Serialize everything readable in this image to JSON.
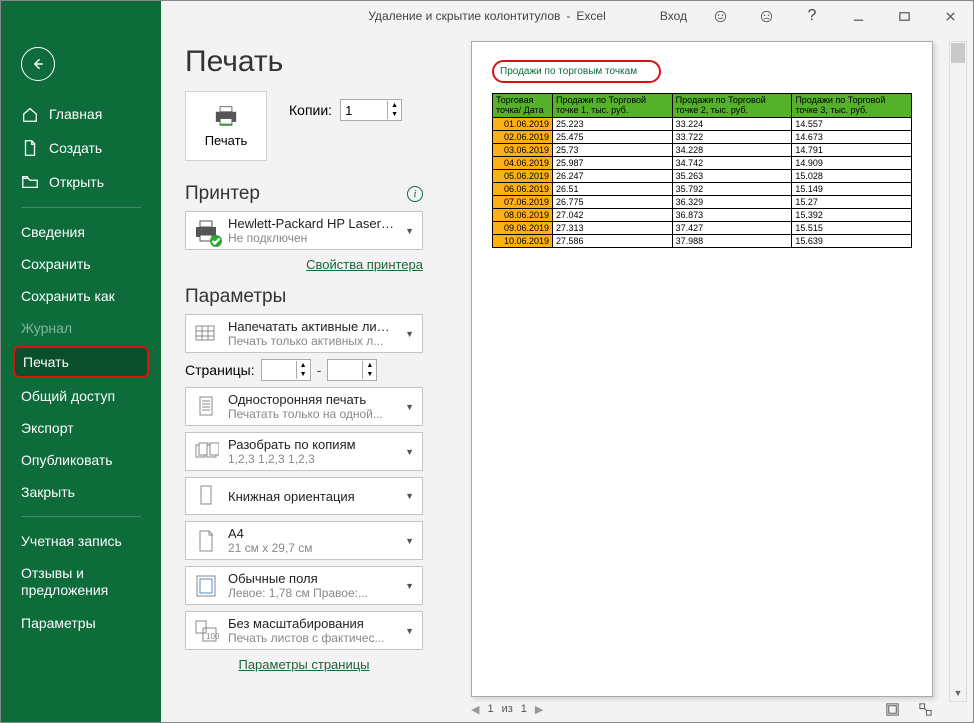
{
  "titlebar": {
    "doc": "Удаление и скрытие колонтитулов",
    "app": "Excel",
    "login": "Вход"
  },
  "sidebar": {
    "home": "Главная",
    "new": "Создать",
    "open": "Открыть",
    "info": "Сведения",
    "save": "Сохранить",
    "saveas": "Сохранить как",
    "history": "Журнал",
    "print": "Печать",
    "share": "Общий доступ",
    "export": "Экспорт",
    "publish": "Опубликовать",
    "close": "Закрыть",
    "account": "Учетная запись",
    "feedback": "Отзывы и предложения",
    "options": "Параметры"
  },
  "main": {
    "title": "Печать",
    "printBtn": "Печать",
    "copiesLabel": "Копии:",
    "copies": "1",
    "printerHeading": "Принтер",
    "printer": {
      "name": "Hewlett-Packard HP LaserJe...",
      "status": "Не подключен"
    },
    "printerProps": "Свойства принтера",
    "paramsHeading": "Параметры",
    "pagesLabel": "Страницы:",
    "pageSetup": "Параметры страницы",
    "drops": {
      "what": {
        "l1": "Напечатать активные листы",
        "l2": "Печать только активных л..."
      },
      "sides": {
        "l1": "Односторонняя печать",
        "l2": "Печатать только на одной..."
      },
      "collate": {
        "l1": "Разобрать по копиям",
        "l2": "1,2,3   1,2,3   1,2,3"
      },
      "orient": {
        "l1": "Книжная ориентация",
        "l2": ""
      },
      "paper": {
        "l1": "A4",
        "l2": "21 см x 29,7 см"
      },
      "margins": {
        "l1": "Обычные поля",
        "l2": "Левое:  1,78 см   Правое:..."
      },
      "scale": {
        "l1": "Без масштабирования",
        "l2": "Печать листов с фактичес..."
      }
    }
  },
  "preview": {
    "header": "Продажи по торговым точкам",
    "cols": [
      "Торговая точка/\nДата",
      "Продажи по Торговой точке 1, тыс. руб.",
      "Продажи по Торговой точке 2, тыс. руб.",
      "Продажи по Торговой точке 3, тыс. руб."
    ],
    "rows": [
      [
        "01.06.2019",
        "25.223",
        "33.224",
        "14.557"
      ],
      [
        "02.06.2019",
        "25.475",
        "33.722",
        "14.673"
      ],
      [
        "03.06.2019",
        "25.73",
        "34.228",
        "14.791"
      ],
      [
        "04.06.2019",
        "25.987",
        "34.742",
        "14.909"
      ],
      [
        "05.06.2019",
        "26.247",
        "35.263",
        "15.028"
      ],
      [
        "06.06.2019",
        "26.51",
        "35.792",
        "15.149"
      ],
      [
        "07.06.2019",
        "26.775",
        "36.329",
        "15.27"
      ],
      [
        "08.06.2019",
        "27.042",
        "36.873",
        "15.392"
      ],
      [
        "09.06.2019",
        "27.313",
        "37.427",
        "15.515"
      ],
      [
        "10.06.2019",
        "27.586",
        "37.988",
        "15.639"
      ]
    ],
    "pager": {
      "page": "1",
      "of": "из",
      "total": "1"
    }
  }
}
